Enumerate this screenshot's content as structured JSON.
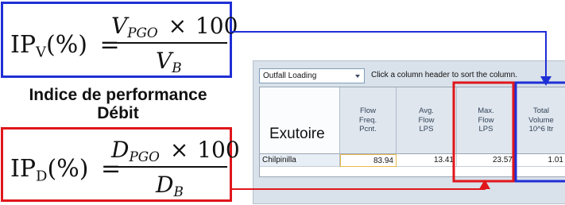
{
  "formula_volume": {
    "lhs_base": "IP",
    "lhs_sub": "V",
    "lhs_unit": "(%)",
    "equals": "=",
    "num_var": "V",
    "num_sub": "PGO",
    "times": "×",
    "num_const": "100",
    "den_var": "V",
    "den_sub": "B"
  },
  "heading": {
    "line1": "Indice de performance",
    "line2": "Débit"
  },
  "formula_debit": {
    "lhs_base": "IP",
    "lhs_sub": "D",
    "lhs_unit": "(%)",
    "equals": "=",
    "num_var": "D",
    "num_sub": "PGO",
    "times": "×",
    "num_const": "100",
    "den_var": "D",
    "den_sub": "B"
  },
  "table_panel": {
    "dropdown_value": "Outfall Loading",
    "hint": "Click a column header to sort the column.",
    "row_header_title": "Exutoire",
    "columns": [
      {
        "label": "Flow\nFreq.\nPcnt."
      },
      {
        "label": "Avg.\nFlow\nLPS"
      },
      {
        "label": "Max.\nFlow\nLPS"
      },
      {
        "label": "Total\nVolume\n10^6 ltr"
      }
    ],
    "rows": [
      {
        "name": "Chilpinilla",
        "values": [
          "83.94",
          "13.41",
          "23.57",
          "1.01"
        ]
      }
    ]
  },
  "colors": {
    "volume_highlight": "#1f2fd6",
    "debit_highlight": "#e0161b",
    "selected_cell_border": "#e8b84a"
  }
}
